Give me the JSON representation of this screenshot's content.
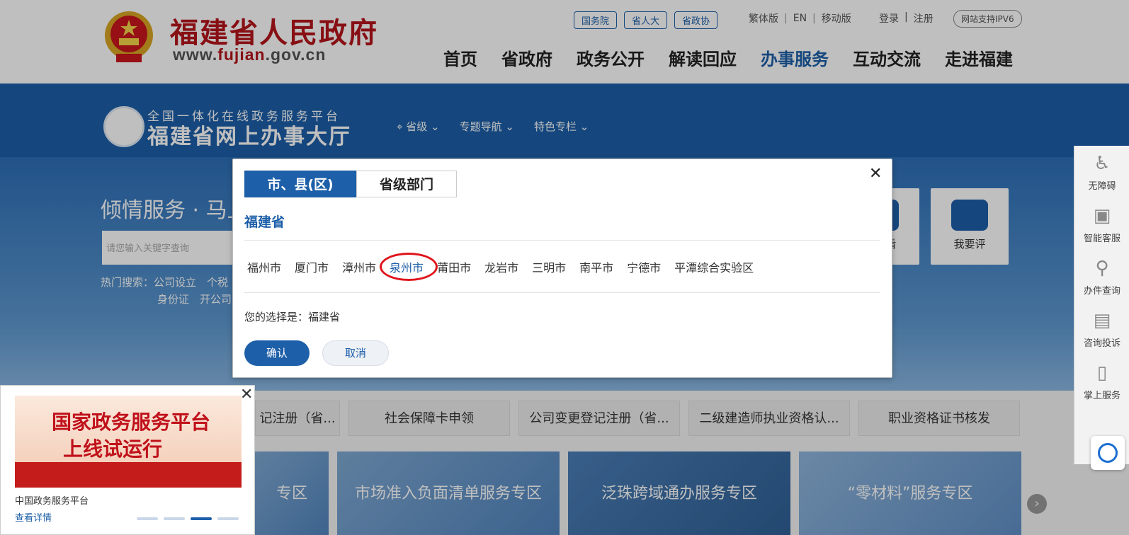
{
  "header": {
    "site_title": "福建省人民政府",
    "url_prefix": "www.",
    "url_highlight": "fujian",
    "url_suffix": ".gov.cn",
    "tags": [
      "国务院",
      "省人大",
      "省政协"
    ],
    "lang_links": [
      "繁体版",
      "EN",
      "移动版"
    ],
    "user_links": [
      "登录",
      "注册"
    ],
    "ipv6_badge": "网站支持IPV6",
    "nav": [
      "首页",
      "省政府",
      "政务公开",
      "解读回应",
      "办事服务",
      "互动交流",
      "走进福建"
    ],
    "nav_active_index": 4
  },
  "hall": {
    "subtitle": "全国一体化在线政务服务平台",
    "title": "福建省网上办事大厅",
    "nav": [
      "省级",
      "专题导航",
      "特色专栏"
    ]
  },
  "hero": {
    "slogan": "倾情服务 · 马上",
    "search_placeholder": "请您输入关键字查询",
    "hot_label": "热门搜索：公司设立　个税",
    "hot_row2": "身份证　开公司",
    "cards": [
      "我要看",
      "我要评"
    ]
  },
  "services": [
    "记注册（省...",
    "社会保障卡申领",
    "公司变更登记注册（省...",
    "二级建造师执业资格认...",
    "职业资格证书核发"
  ],
  "zones": [
    "专区",
    "市场准入负面清单服务专区",
    "泛珠跨域通办服务专区",
    "“零材料”服务专区"
  ],
  "side_bar": [
    "无障碍",
    "智能客服",
    "办件查询",
    "咨询投诉",
    "掌上服务"
  ],
  "promo": {
    "banner_line1": "国家政务服务平台",
    "banner_line2": "上线试运行",
    "name": "中国政务服务平台",
    "link": "查看详情",
    "close": "✕"
  },
  "modal": {
    "tabs": [
      "市、县(区)",
      "省级部门"
    ],
    "province": "福建省",
    "cities": [
      "福州市",
      "厦门市",
      "漳州市",
      "泉州市",
      "莆田市",
      "龙岩市",
      "三明市",
      "南平市",
      "宁德市",
      "平潭综合实验区"
    ],
    "selected_city_index": 3,
    "choice_prefix": "您的选择是：",
    "choice_value": "福建省",
    "confirm": "确认",
    "cancel": "取消",
    "close": "✕"
  },
  "colors": {
    "brand_blue": "#1d5fa8",
    "title_red": "#b5151b",
    "highlight_ring": "#e0141b"
  }
}
